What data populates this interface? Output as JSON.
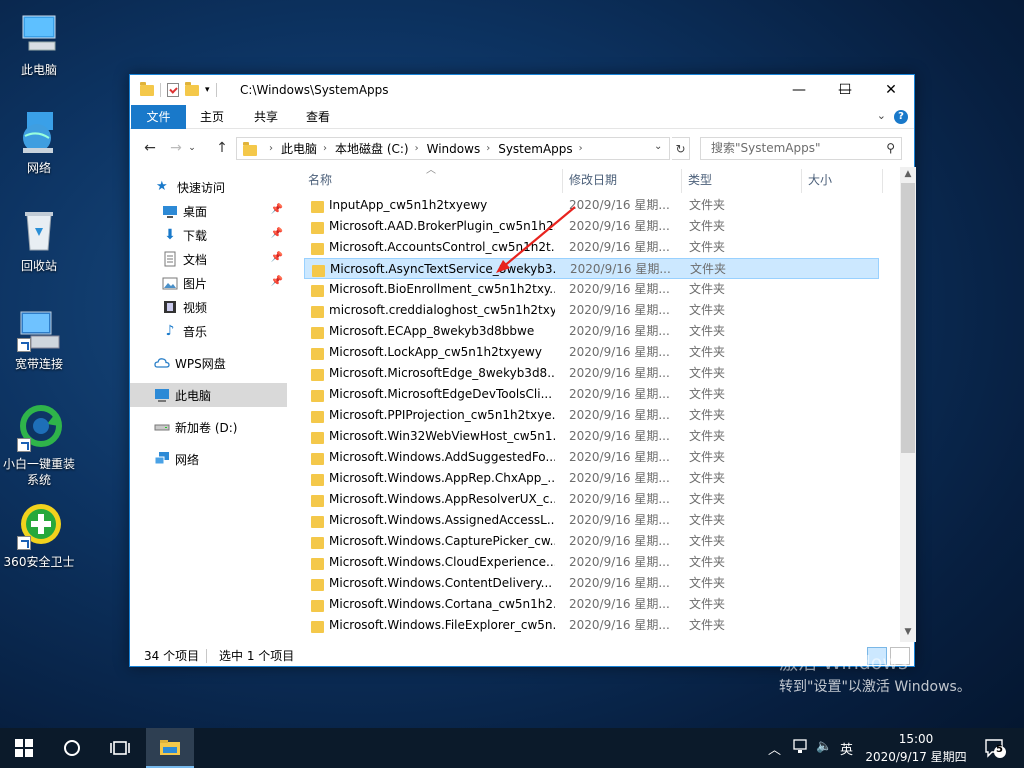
{
  "desktop": {
    "icons": [
      {
        "label": "此电脑"
      },
      {
        "label": "网络"
      },
      {
        "label": "回收站"
      },
      {
        "label": "宽带连接"
      },
      {
        "label": "小白一键重装系统"
      },
      {
        "label": "360安全卫士"
      }
    ]
  },
  "window": {
    "title": "C:\\Windows\\SystemApps",
    "controls": {
      "minimize": "—",
      "maximize": "☐",
      "close": "✕"
    },
    "ribbon_tabs": [
      "文件",
      "主页",
      "共享",
      "查看"
    ],
    "help": "?",
    "address": {
      "crumbs": [
        "此电脑",
        "本地磁盘 (C:)",
        "Windows",
        "SystemApps"
      ]
    },
    "search": {
      "placeholder": "搜索\"SystemApps\""
    },
    "nav": {
      "quick_access": "快速访问",
      "items": [
        {
          "label": "桌面",
          "pinned": true
        },
        {
          "label": "下载",
          "pinned": true
        },
        {
          "label": "文档",
          "pinned": true
        },
        {
          "label": "图片",
          "pinned": true
        },
        {
          "label": "视频",
          "pinned": false
        },
        {
          "label": "音乐",
          "pinned": false
        }
      ],
      "wps": "WPS网盘",
      "this_pc": "此电脑",
      "drive": "新加卷 (D:)",
      "network": "网络"
    },
    "columns": {
      "name": "名称",
      "date": "修改日期",
      "type": "类型",
      "size": "大小"
    },
    "files": [
      {
        "name": "InputApp_cw5n1h2txyewy",
        "date": "2020/9/16 星期...",
        "type": "文件夹"
      },
      {
        "name": "Microsoft.AAD.BrokerPlugin_cw5n1h2...",
        "date": "2020/9/16 星期...",
        "type": "文件夹"
      },
      {
        "name": "Microsoft.AccountsControl_cw5n1h2t...",
        "date": "2020/9/16 星期...",
        "type": "文件夹"
      },
      {
        "name": "Microsoft.AsyncTextService_8wekyb3...",
        "date": "2020/9/16 星期...",
        "type": "文件夹",
        "selected": true
      },
      {
        "name": "Microsoft.BioEnrollment_cw5n1h2txy...",
        "date": "2020/9/16 星期...",
        "type": "文件夹"
      },
      {
        "name": "microsoft.creddialoghost_cw5n1h2txy...",
        "date": "2020/9/16 星期...",
        "type": "文件夹"
      },
      {
        "name": "Microsoft.ECApp_8wekyb3d8bbwe",
        "date": "2020/9/16 星期...",
        "type": "文件夹"
      },
      {
        "name": "Microsoft.LockApp_cw5n1h2txyewy",
        "date": "2020/9/16 星期...",
        "type": "文件夹"
      },
      {
        "name": "Microsoft.MicrosoftEdge_8wekyb3d8...",
        "date": "2020/9/16 星期...",
        "type": "文件夹"
      },
      {
        "name": "Microsoft.MicrosoftEdgeDevToolsCli...",
        "date": "2020/9/16 星期...",
        "type": "文件夹"
      },
      {
        "name": "Microsoft.PPIProjection_cw5n1h2txye...",
        "date": "2020/9/16 星期...",
        "type": "文件夹"
      },
      {
        "name": "Microsoft.Win32WebViewHost_cw5n1...",
        "date": "2020/9/16 星期...",
        "type": "文件夹"
      },
      {
        "name": "Microsoft.Windows.AddSuggestedFo...",
        "date": "2020/9/16 星期...",
        "type": "文件夹"
      },
      {
        "name": "Microsoft.Windows.AppRep.ChxApp_...",
        "date": "2020/9/16 星期...",
        "type": "文件夹"
      },
      {
        "name": "Microsoft.Windows.AppResolverUX_c...",
        "date": "2020/9/16 星期...",
        "type": "文件夹"
      },
      {
        "name": "Microsoft.Windows.AssignedAccessL...",
        "date": "2020/9/16 星期...",
        "type": "文件夹"
      },
      {
        "name": "Microsoft.Windows.CapturePicker_cw...",
        "date": "2020/9/16 星期...",
        "type": "文件夹"
      },
      {
        "name": "Microsoft.Windows.CloudExperience...",
        "date": "2020/9/16 星期...",
        "type": "文件夹"
      },
      {
        "name": "Microsoft.Windows.ContentDelivery...",
        "date": "2020/9/16 星期...",
        "type": "文件夹"
      },
      {
        "name": "Microsoft.Windows.Cortana_cw5n1h2...",
        "date": "2020/9/16 星期...",
        "type": "文件夹"
      },
      {
        "name": "Microsoft.Windows.FileExplorer_cw5n...",
        "date": "2020/9/16 星期...",
        "type": "文件夹"
      }
    ],
    "status": {
      "count": "34 个项目",
      "selected": "选中 1 个项目"
    }
  },
  "watermark": {
    "line1": "激活 Windows",
    "line2": "转到\"设置\"以激活 Windows。"
  },
  "taskbar": {
    "ime": "英",
    "time": "15:00",
    "date": "2020/9/17 星期四",
    "notifications": "5"
  },
  "colors": {
    "accent": "#1979ca",
    "selection": "#cce8ff",
    "folder": "#f4c84a",
    "annotation": "#e8231e"
  }
}
